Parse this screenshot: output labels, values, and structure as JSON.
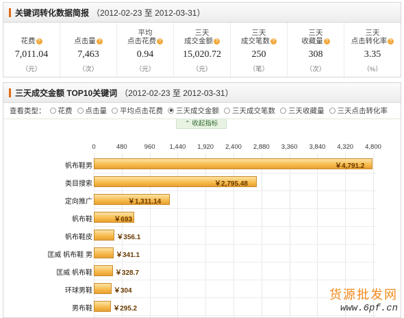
{
  "summary": {
    "title": "关键词转化数据简报",
    "date_range": "（2012-02-23 至  2012-03-31）",
    "metrics": [
      {
        "label": "花费",
        "value": "7,011.04",
        "unit": "（元）"
      },
      {
        "label": "点击量",
        "value": "7,463",
        "unit": "（次）"
      },
      {
        "label": "平均\n点击花费",
        "value": "0.94",
        "unit": "（元）"
      },
      {
        "label": "三天\n成交金额",
        "value": "15,020.72",
        "unit": "（元）"
      },
      {
        "label": "三天\n成交笔数",
        "value": "250",
        "unit": "（笔）"
      },
      {
        "label": "三天\n收藏量",
        "value": "308",
        "unit": "（次）"
      },
      {
        "label": "三天\n点击转化率",
        "value": "3.35",
        "unit": "（%）"
      }
    ]
  },
  "top10": {
    "title": "三天成交金额  TOP10关键词",
    "date_range": "（2012-02-23 至  2012-03-31）",
    "filter_label": "查看类型：",
    "options": [
      "花费",
      "点击量",
      "平均点击花费",
      "三天成交金额",
      "三天成交笔数",
      "三天收藏量",
      "三天点击转化率"
    ],
    "selected_index": 3,
    "collapse_label": "⌃ 收起指标"
  },
  "chart_data": {
    "type": "bar",
    "orientation": "horizontal",
    "categories": [
      "帆布鞋男",
      "类目搜索",
      "定向推广",
      "帆布鞋",
      "帆布鞋皮",
      "匡威 帆布鞋 男",
      "匡威 帆布鞋",
      "环球男鞋",
      "男布鞋"
    ],
    "values": [
      4791.2,
      2795.48,
      1311.14,
      693,
      356.1,
      341.1,
      328.7,
      304,
      295.2
    ],
    "value_labels": [
      "￥4,791.2",
      "￥2,795.48",
      "￥1,311.14",
      "￥693",
      "￥356.1",
      "￥341.1",
      "￥328.7",
      "￥304",
      "￥295.2"
    ],
    "ticks": [
      "0",
      "480",
      "960",
      "1,440",
      "1,920",
      "2,400",
      "2,880",
      "3,360",
      "3,840",
      "4,320",
      "4,800"
    ],
    "xlim": [
      0,
      4800
    ],
    "axis_position": "top",
    "bar_color": "#f6ba4b",
    "grid": true
  },
  "watermark": {
    "line1": "货源批发网",
    "line2": "www.6pf.cn"
  }
}
